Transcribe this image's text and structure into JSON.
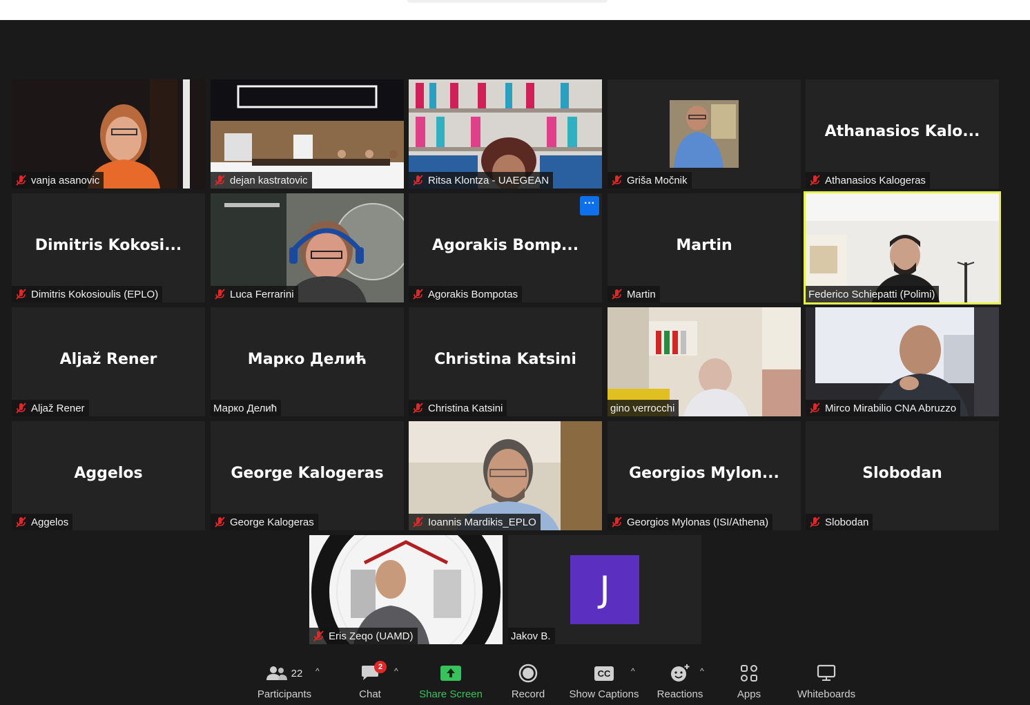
{
  "participants": [
    {
      "label": "vanja asanovic",
      "muted": true
    },
    {
      "label": "dejan kastratovic",
      "muted": true
    },
    {
      "label": "Ritsa Klontza - UAEGEAN",
      "muted": true
    },
    {
      "label": "Griša Močnik",
      "muted": true
    },
    {
      "big": "Athanasios  Kalo...",
      "label": "Athanasios Kalogeras",
      "muted": true
    },
    {
      "big": "Dimitris  Kokosi...",
      "label": "Dimitris Kokosioulis (EPLO)",
      "muted": true
    },
    {
      "label": "Luca Ferrarini",
      "muted": true
    },
    {
      "big": "Agorakis  Bomp...",
      "label": "Agorakis Bompotas",
      "muted": true,
      "more": "···"
    },
    {
      "big": "Martin",
      "label": "Martin",
      "muted": true
    },
    {
      "label": "Federico Schiepatti (Polimi)",
      "muted": false,
      "active": true
    },
    {
      "big": "Aljaž Rener",
      "label": "Aljaž Rener",
      "muted": true
    },
    {
      "big": "Марко Делић",
      "label": "Марко Делић",
      "muted": false
    },
    {
      "big": "Christina Katsini",
      "label": "Christina Katsini",
      "muted": true
    },
    {
      "label": "gino verrocchi",
      "muted": false
    },
    {
      "label": "Mirco Mirabilio CNA Abruzzo",
      "muted": true
    },
    {
      "big": "Aggelos",
      "label": "Aggelos",
      "muted": true
    },
    {
      "big": "George Kalogeras",
      "label": "George Kalogeras",
      "muted": true
    },
    {
      "label": "Ioannis Mardikis_EPLO",
      "muted": true
    },
    {
      "big": "Georgios  Mylon...",
      "label": "Georgios Mylonas (ISI/Athena)",
      "muted": true
    },
    {
      "big": "Slobodan",
      "label": "Slobodan",
      "muted": true
    },
    {
      "label": "Eris Zeqo (UAMD)",
      "muted": true
    },
    {
      "label": "Jakov B.",
      "muted": false,
      "avatar": "J"
    }
  ],
  "toolbar": {
    "participants_label": "Participants",
    "participants_count": "22",
    "chat_label": "Chat",
    "chat_badge": "2",
    "share_label": "Share Screen",
    "record_label": "Record",
    "captions_label": "Show Captions",
    "captions_icon_text": "CC",
    "reactions_label": "Reactions",
    "apps_label": "Apps",
    "whiteboards_label": "Whiteboards",
    "caret": "^"
  },
  "colors": {
    "background": "#1a1a1a",
    "tile": "#232323",
    "active_speaker": "#e6f24a",
    "share_green": "#37c35a",
    "mute_red": "#e02828",
    "avatar_purple": "#5b2fbf"
  }
}
